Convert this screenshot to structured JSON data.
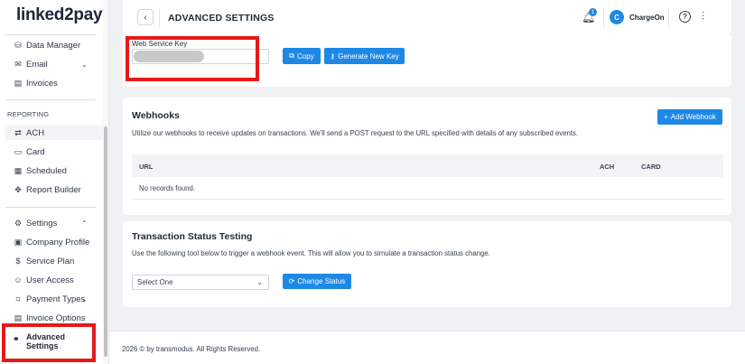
{
  "brand": {
    "logo_text_a": "linked",
    "logo_text_b": "2",
    "logo_text_c": "pay"
  },
  "sidebar": {
    "items_top": [
      {
        "label": "Data Manager",
        "icon": "database-icon"
      },
      {
        "label": "Email",
        "icon": "envelope-icon"
      },
      {
        "label": "Invoices",
        "icon": "document-icon"
      }
    ],
    "section_reporting": "REPORTING",
    "reporting_items": [
      {
        "label": "ACH",
        "icon": "transfer-icon"
      },
      {
        "label": "Card",
        "icon": "credit-card-icon"
      },
      {
        "label": "Scheduled",
        "icon": "calendar-icon"
      },
      {
        "label": "Report Builder",
        "icon": "puzzle-icon"
      }
    ],
    "settings_items": [
      {
        "label": "Settings",
        "icon": "gear-icon"
      },
      {
        "label": "Company Profile",
        "icon": "briefcase-icon"
      },
      {
        "label": "Service Plan",
        "icon": "dollar-icon"
      },
      {
        "label": "User Access",
        "icon": "user-icon"
      },
      {
        "label": "Payment Types",
        "icon": "tag-icon"
      },
      {
        "label": "Invoice Options",
        "icon": "document-icon"
      }
    ],
    "advanced_line1": "Advanced",
    "advanced_line2": "Settings"
  },
  "header": {
    "title": "ADVANCED SETTINGS",
    "notification_count": "1",
    "avatar_letter": "C",
    "user_name": "ChargeOn",
    "help_glyph": "?"
  },
  "web_service": {
    "label": "Web Service Key",
    "copy_label": "Copy",
    "generate_label": "Generate New Key"
  },
  "webhooks": {
    "title": "Webhooks",
    "add_label": "Add Webhook",
    "description": "Utilize our webhooks to receive updates on transactions. We'll send a POST request to the URL specified with details of any subscribed events.",
    "columns": [
      "URL",
      "ACH",
      "CARD"
    ],
    "empty_text": "No records found."
  },
  "transaction_testing": {
    "title": "Transaction Status Testing",
    "description": "Use the following tool below to trigger a webhook event. This will allow you to simulate a transaction status change.",
    "select_value": "Select One",
    "change_label": "Change Status"
  },
  "footer": {
    "text": "2026 © by transmodus. All Rights Reserved."
  },
  "colors": {
    "accent": "#1e88e5",
    "highlight": "#e41a1a"
  }
}
